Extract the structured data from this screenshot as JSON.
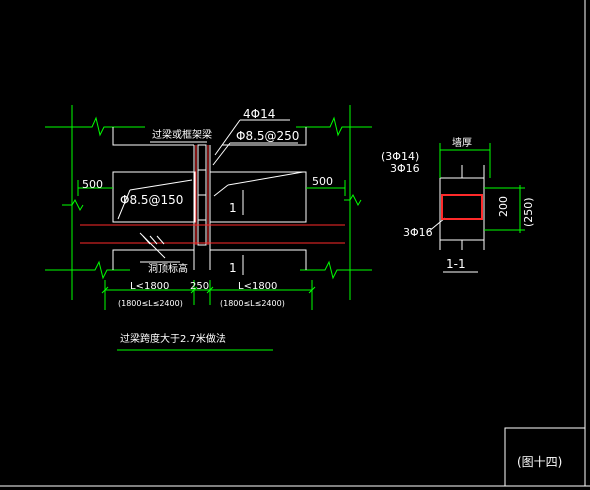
{
  "drawing": {
    "labels": {
      "lintel_label": "过梁或框架梁",
      "top_bar": "4Φ14",
      "stirrup_mid": "Φ8.5@250",
      "stirrup_left": "Φ8.5@150",
      "dim_left_500": "500",
      "dim_right_500": "500",
      "opening_top": "洞顶标高",
      "one_a": "1",
      "one_b": "1",
      "l_left": "L<1800",
      "l_mid": "250",
      "l_right": "L<1800",
      "range_left": "(1800≤L≤2400)",
      "range_right": "(1800≤L≤2400)",
      "note": "过梁跨度大于2.7米做法"
    },
    "section": {
      "top_alt": "(3Φ14)",
      "top_main": "3Φ16",
      "wall_thk": "墙厚",
      "height_200": "200",
      "height_250": "(250)",
      "bottom_bar": "3Φ16",
      "section_label": "1-1"
    },
    "sheet": {
      "figure_label": "(图十四)"
    },
    "colors": {
      "background": "#000000",
      "lines": "#ffffff",
      "dims": "#00ff00",
      "rebar": "#ff2a2a"
    }
  }
}
